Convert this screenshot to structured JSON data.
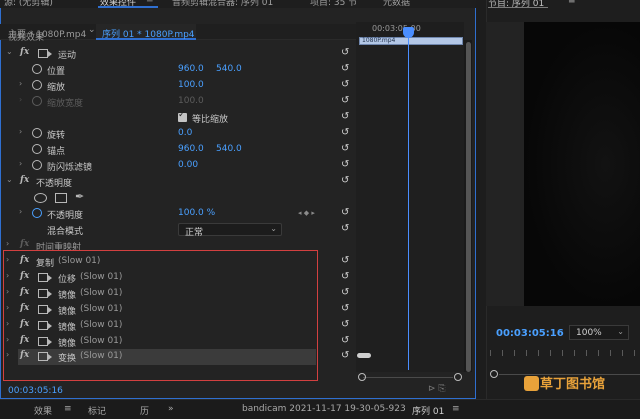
{
  "tabs": {
    "source": "源: (无剪辑)",
    "effect_controls": "效果控件",
    "effect_controls_menu": "≡",
    "audio_mixer": "音频剪辑混合器: 序列 01",
    "project": "项目: 35 节",
    "metadata": "元数据",
    "program": "节目: 序列 01",
    "program_menu": "≡"
  },
  "subheader": {
    "master": "主要 * 1080P.mp4",
    "chevron": "⌄",
    "sequence": "序列 01 * 1080P.mp4"
  },
  "mini_timeline": {
    "timecode": "00:03:05:00",
    "clip_label": "1080P.mp4"
  },
  "video_effects_header": "视频效果",
  "rows": {
    "motion": "运动",
    "position": "位置",
    "position_x": "960.0",
    "position_y": "540.0",
    "scale": "缩放",
    "scale_val": "100.0",
    "scale_width": "缩放宽度",
    "scale_width_val": "100.0",
    "uniform_scale": "等比缩放",
    "rotation": "旋转",
    "rotation_val": "0.0",
    "anchor": "锚点",
    "anchor_x": "960.0",
    "anchor_y": "540.0",
    "anti_flicker": "防闪烁滤镜",
    "anti_flicker_val": "0.00",
    "opacity": "不透明度",
    "opacity_sub": "不透明度",
    "opacity_val": "100.0 %",
    "keyframe_nav": "◂ ◆ ▸",
    "blend_mode": "混合模式",
    "blend_mode_val": "正常",
    "time_remap": "时间重映射",
    "copy": "复制",
    "copy_suffix": "(Slow 01)",
    "offset": "位移",
    "offset_suffix": "(Slow 01)",
    "mirror1": "镜像",
    "mirror1_suffix": "(Slow 01)",
    "mirror2": "镜像",
    "mirror2_suffix": "(Slow 01)",
    "mirror3": "镜像",
    "mirror3_suffix": "(Slow 01)",
    "mirror4": "镜像",
    "mirror4_suffix": "(Slow 01)",
    "transform": "变换",
    "transform_suffix": "(Slow 01)"
  },
  "footer": {
    "timecode": "00:03:05:16"
  },
  "program": {
    "timecode": "00:03:05:16",
    "zoom": "100%"
  },
  "watermark": "草丁图书馆",
  "bottom_bar": {
    "effects": "效果",
    "effects_menu": "≡",
    "markers": "标记",
    "history": "历",
    "more": "»",
    "bandicam": "bandicam 2021-11-17 19-30-05-923",
    "sequence": "序列 01",
    "sequence_menu": "≡"
  },
  "colors": {
    "accent_blue": "#4aa0ff",
    "selection_border": "#d24040",
    "watermark": "#e8a23a"
  }
}
